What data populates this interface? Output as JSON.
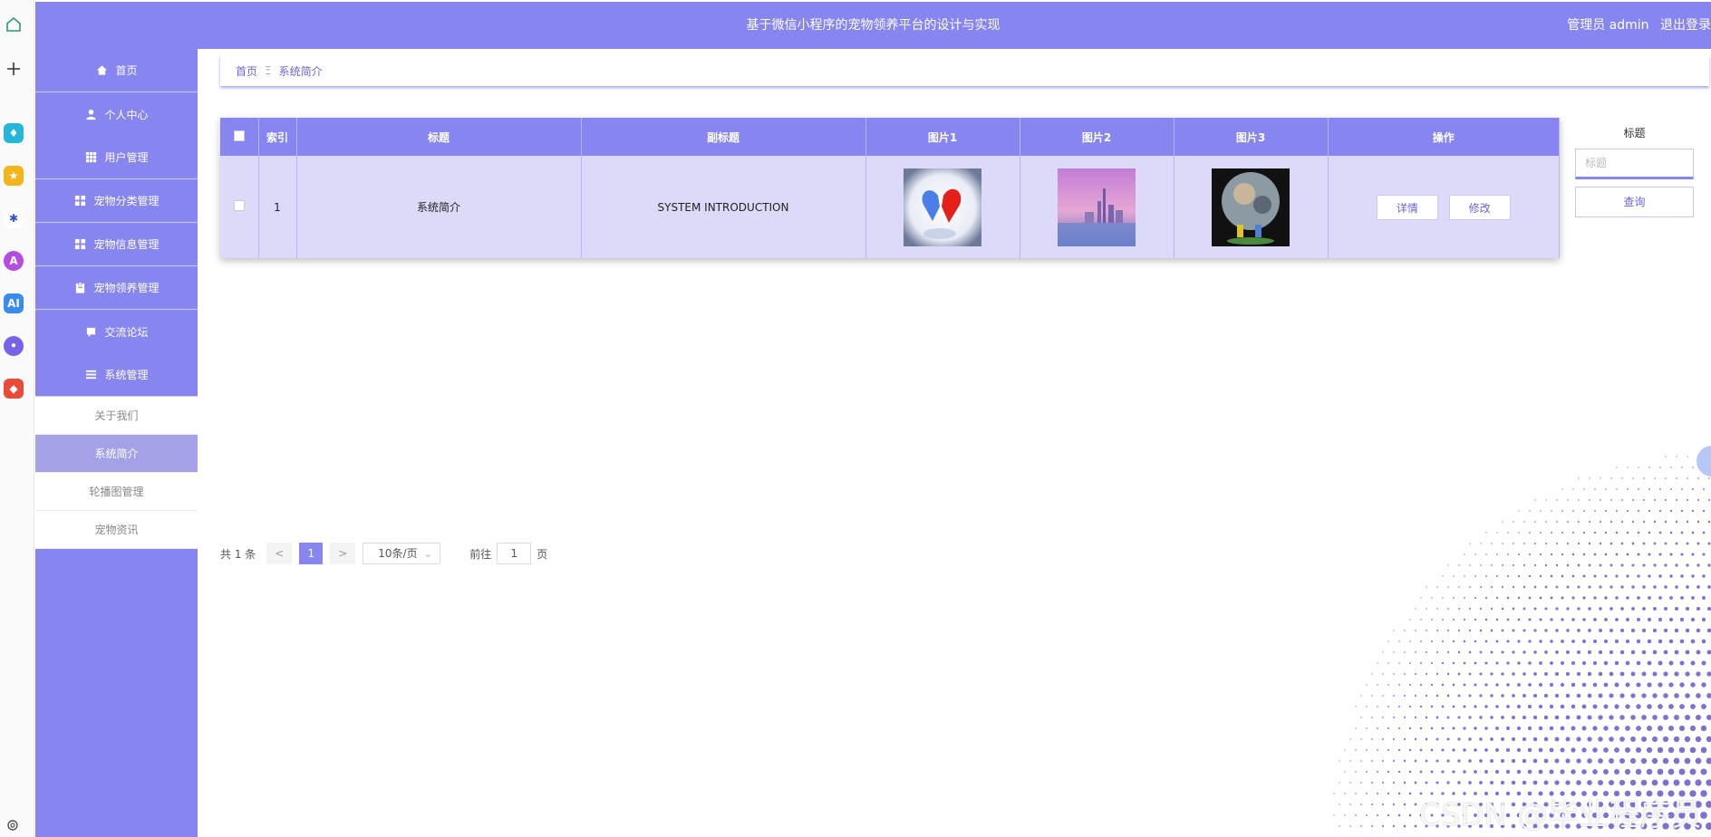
{
  "app": {
    "title": "基于微信小程序的宠物领养平台的设计与实现",
    "user_label": "管理员 admin",
    "logout_label": "退出登录"
  },
  "sidebar": {
    "items": [
      {
        "label": "首页",
        "icon": "home-icon"
      },
      {
        "label": "个人中心",
        "icon": "user-icon"
      },
      {
        "label": "用户管理",
        "icon": "grid-icon"
      },
      {
        "label": "宠物分类管理",
        "icon": "apps-icon"
      },
      {
        "label": "宠物信息管理",
        "icon": "apps-icon"
      },
      {
        "label": "宠物领养管理",
        "icon": "clipboard-icon"
      },
      {
        "label": "交流论坛",
        "icon": "chat-icon"
      },
      {
        "label": "系统管理",
        "icon": "list-icon"
      }
    ],
    "submenu": [
      {
        "label": "关于我们"
      },
      {
        "label": "系统简介",
        "active": true
      },
      {
        "label": "轮播图管理"
      },
      {
        "label": "宠物资讯"
      }
    ]
  },
  "breadcrumb": {
    "home": "首页",
    "separator": "Ξ",
    "current": "系统简介"
  },
  "table": {
    "headers": [
      "索引",
      "标题",
      "副标题",
      "图片1",
      "图片2",
      "图片3",
      "操作"
    ],
    "rows": [
      {
        "index": "1",
        "title": "系统简介",
        "subtitle": "SYSTEM INTRODUCTION",
        "images": [
          "two-hearts-image",
          "city-skyline-image",
          "planet-figures-image"
        ],
        "actions": [
          "详情",
          "修改"
        ]
      }
    ]
  },
  "search": {
    "label": "标题",
    "placeholder": "标题",
    "button": "查询"
  },
  "pagination": {
    "total_text": "共 1 条",
    "prev": "<",
    "current_page": "1",
    "next": ">",
    "page_size": "10条/页",
    "goto_label": "前往",
    "goto_value": "1",
    "page_suffix": "页"
  },
  "watermark": "CSDN @毕业程序员",
  "colors": {
    "primary": "#8785f0",
    "row_bg": "#dcdaf8",
    "active_sub": "#a4a1e8"
  }
}
